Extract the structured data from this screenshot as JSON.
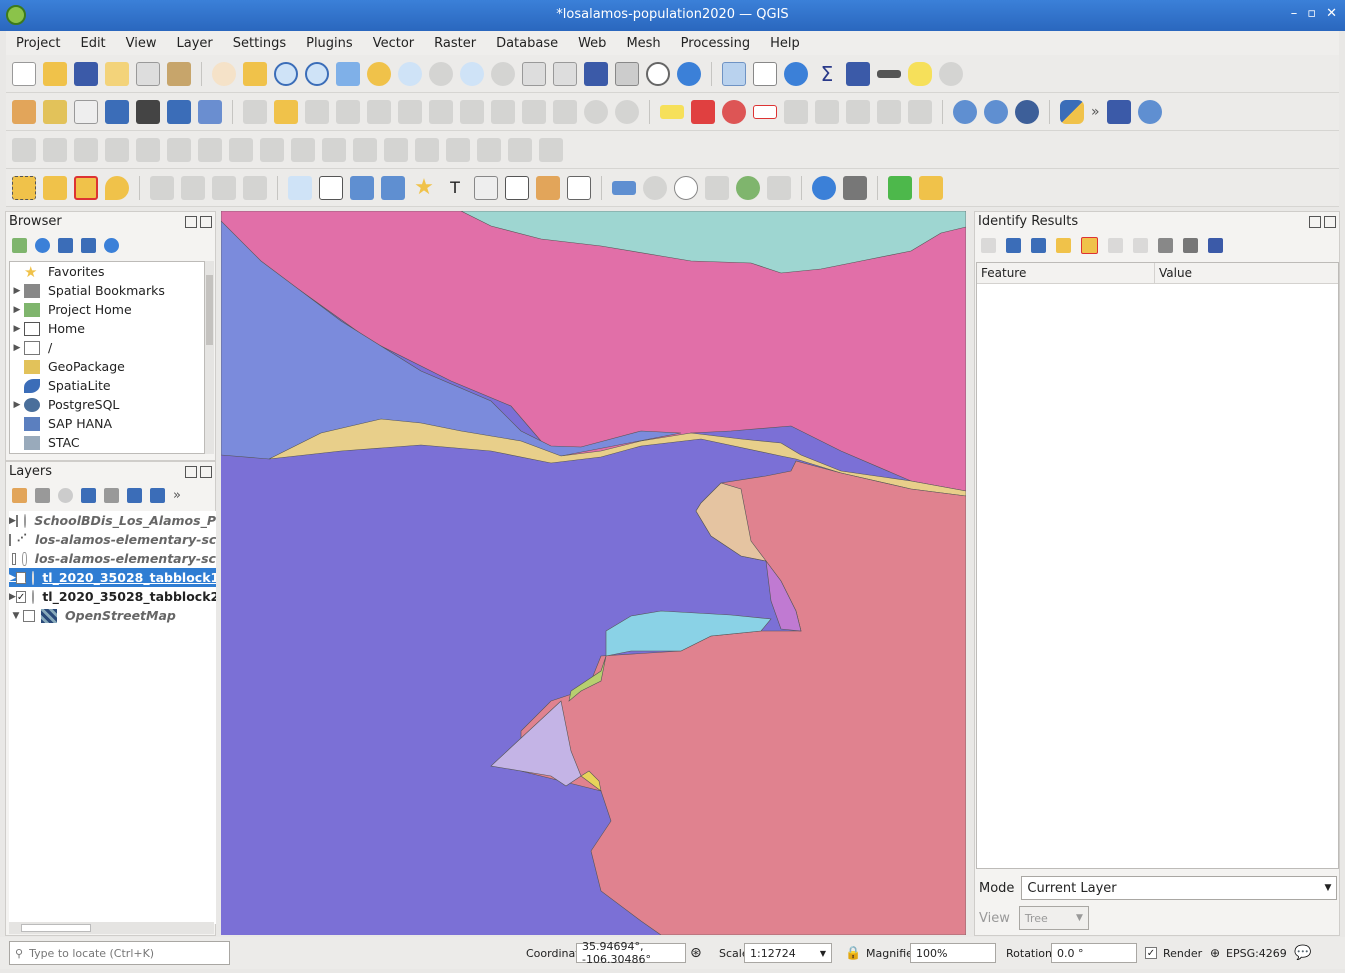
{
  "window": {
    "title": "*losalamos-population2020 — QGIS"
  },
  "menu": [
    "Project",
    "Edit",
    "View",
    "Layer",
    "Settings",
    "Plugins",
    "Vector",
    "Raster",
    "Database",
    "Web",
    "Mesh",
    "Processing",
    "Help"
  ],
  "browser": {
    "title": "Browser",
    "items": [
      {
        "label": "Favorites",
        "icon": "star-icon",
        "arrow": false
      },
      {
        "label": "Spatial Bookmarks",
        "icon": "bookmark-icon",
        "arrow": true
      },
      {
        "label": "Project Home",
        "icon": "folder-green-icon",
        "arrow": true
      },
      {
        "label": "Home",
        "icon": "home-icon",
        "arrow": true
      },
      {
        "label": "/",
        "icon": "folder-icon",
        "arrow": true
      },
      {
        "label": "GeoPackage",
        "icon": "geopackage-icon",
        "arrow": false
      },
      {
        "label": "SpatiaLite",
        "icon": "spatialite-icon",
        "arrow": false
      },
      {
        "label": "PostgreSQL",
        "icon": "postgresql-icon",
        "arrow": true
      },
      {
        "label": "SAP HANA",
        "icon": "sap-hana-icon",
        "arrow": false
      },
      {
        "label": "STAC",
        "icon": "stac-icon",
        "arrow": false
      }
    ]
  },
  "layers": {
    "title": "Layers",
    "items": [
      {
        "label": "SchoolBDis_Los_Alamos_P",
        "checked": false,
        "arrow": "right",
        "italic": true,
        "selected": false
      },
      {
        "label": "los-alamos-elementary-sc",
        "checked": false,
        "arrow": "",
        "italic": true,
        "selected": false
      },
      {
        "label": "los-alamos-elementary-sc",
        "checked": false,
        "arrow": "",
        "italic": true,
        "selected": false
      },
      {
        "label": "tl_2020_35028_tabblock1",
        "checked": true,
        "arrow": "right",
        "italic": false,
        "selected": true
      },
      {
        "label": "tl_2020_35028_tabblock2",
        "checked": true,
        "arrow": "right",
        "italic": false,
        "selected": false
      },
      {
        "label": "OpenStreetMap",
        "checked": false,
        "arrow": "down",
        "italic": true,
        "selected": false
      }
    ]
  },
  "identify": {
    "title": "Identify Results",
    "col_feature": "Feature",
    "col_value": "Value",
    "mode_label": "Mode",
    "mode_value": "Current Layer",
    "view_label": "View",
    "view_value": "Tree"
  },
  "status": {
    "locate_placeholder": "Type to locate (Ctrl+K)",
    "coordinate_label": "Coordinate",
    "coordinate_value": "35.94694°, -106.30486°",
    "scale_label": "Scale",
    "scale_value": "1:12724",
    "magnifier_label": "Magnifier",
    "magnifier_value": "100%",
    "rotation_label": "Rotation",
    "rotation_value": "0.0 °",
    "render_label": "Render",
    "crs": "EPSG:4269"
  },
  "colors": {
    "selection": "#2f7dd3",
    "map_blue": "#7b70d6",
    "map_pink": "#e07aa8",
    "map_salmon": "#e0828f",
    "map_teal": "#9ed6d1"
  }
}
